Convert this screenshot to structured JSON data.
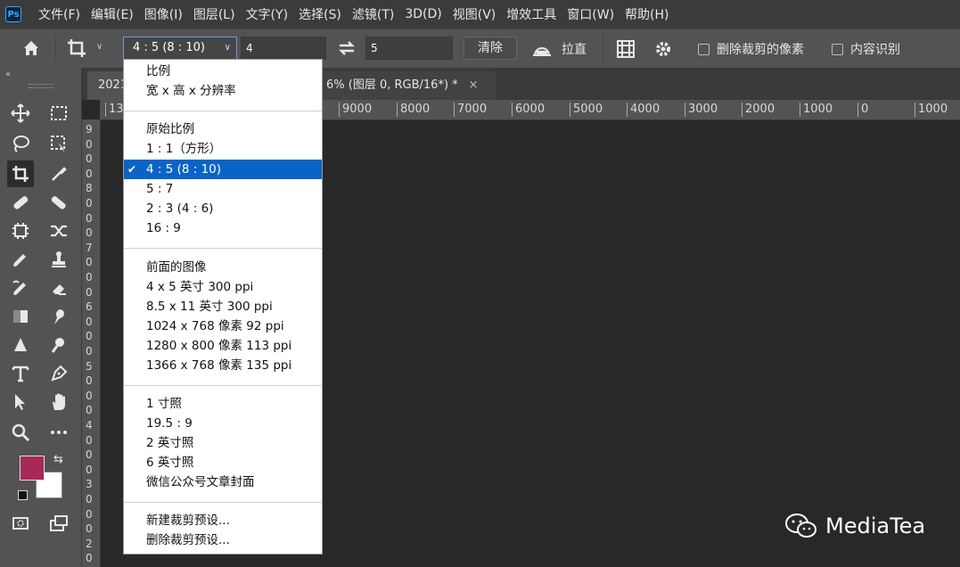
{
  "app": {
    "logo_text": "Ps"
  },
  "menubar": [
    "文件(F)",
    "编辑(E)",
    "图像(I)",
    "图层(L)",
    "文字(Y)",
    "选择(S)",
    "滤镜(T)",
    "3D(D)",
    "视图(V)",
    "增效工具",
    "窗口(W)",
    "帮助(H)"
  ],
  "options": {
    "ratio_value": "4 : 5 (8 : 10)",
    "width_value": "4",
    "height_value": "5",
    "clear_label": "清除",
    "straighten_label": "拉直",
    "delete_cropped_label": "删除裁剪的像素",
    "content_aware_label": "内容识别"
  },
  "tabs": [
    {
      "label": "2021"
    },
    {
      "label": "6% (图层 0, RGB/16*) *",
      "close": "×"
    }
  ],
  "ruler_h": [
    "13",
    "9000",
    "8000",
    "7000",
    "6000",
    "5000",
    "4000",
    "3000",
    "2000",
    "1000",
    "0",
    "1000"
  ],
  "ruler_v": [
    "9",
    "0",
    "0",
    "0",
    "8",
    "0",
    "0",
    "0",
    "7",
    "0",
    "0",
    "0",
    "6",
    "0",
    "0",
    "0",
    "5",
    "0",
    "0",
    "0",
    "4",
    "0",
    "0",
    "0",
    "3",
    "0",
    "0",
    "0",
    "2",
    "0"
  ],
  "ratio_menu": {
    "groups": [
      [
        "比例",
        "宽 x 高 x 分辨率"
      ],
      [
        "原始比例",
        "1 : 1（方形）",
        "4 : 5 (8 : 10)",
        "5 : 7",
        "2 : 3 (4 : 6)",
        "16 : 9"
      ],
      [
        "前面的图像",
        "4 x 5 英寸 300 ppi",
        "8.5 x 11 英寸 300 ppi",
        "1024 x 768 像素 92 ppi",
        "1280 x 800 像素 113 ppi",
        "1366 x 768 像素 135 ppi"
      ],
      [
        "1 寸照",
        "19.5 : 9",
        "2 英寸照",
        "6 英寸照",
        "微信公众号文章封面"
      ],
      [
        "新建裁剪预设...",
        "删除裁剪预设..."
      ]
    ],
    "selected": "4 : 5 (8 : 10)",
    "check_glyph": "✔"
  },
  "colors": {
    "foreground": "#a8285a",
    "background": "#ffffff",
    "selection": "#0a64c8"
  },
  "watermark": {
    "text": "MediaTea",
    "icon": "wechat-icon"
  }
}
